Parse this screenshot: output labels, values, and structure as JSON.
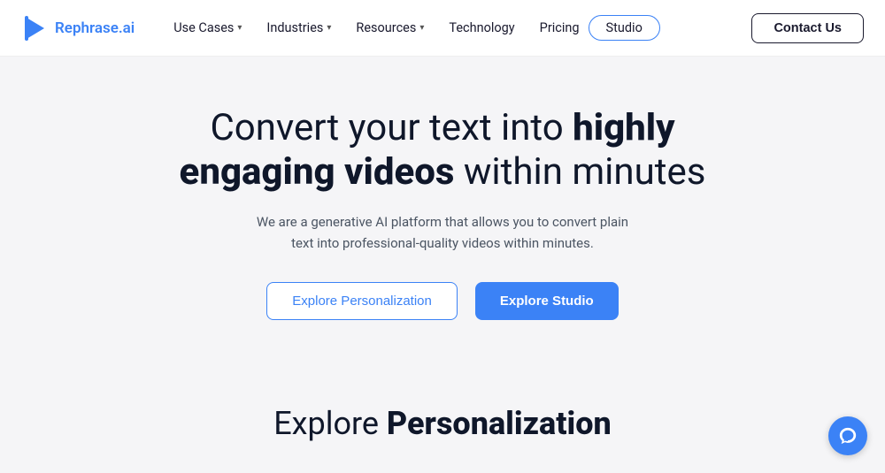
{
  "logo": {
    "text": "Rephrase.ai"
  },
  "nav": {
    "items": [
      {
        "label": "Use Cases",
        "hasChevron": true
      },
      {
        "label": "Industries",
        "hasChevron": true
      },
      {
        "label": "Resources",
        "hasChevron": true
      },
      {
        "label": "Technology",
        "hasChevron": false
      },
      {
        "label": "Pricing",
        "hasChevron": false
      }
    ],
    "studio_label": "Studio",
    "contact_label": "Contact Us"
  },
  "hero": {
    "title_part1": "Convert your text into ",
    "title_bold": "highly engaging videos",
    "title_part2": " within minutes",
    "subtitle": "We are a generative AI platform that allows you to convert plain text into professional-quality videos within minutes.",
    "btn_outline": "Explore Personalization",
    "btn_solid": "Explore Studio"
  },
  "explore_section": {
    "title_normal": "Explore ",
    "title_bold": "Personalization"
  }
}
